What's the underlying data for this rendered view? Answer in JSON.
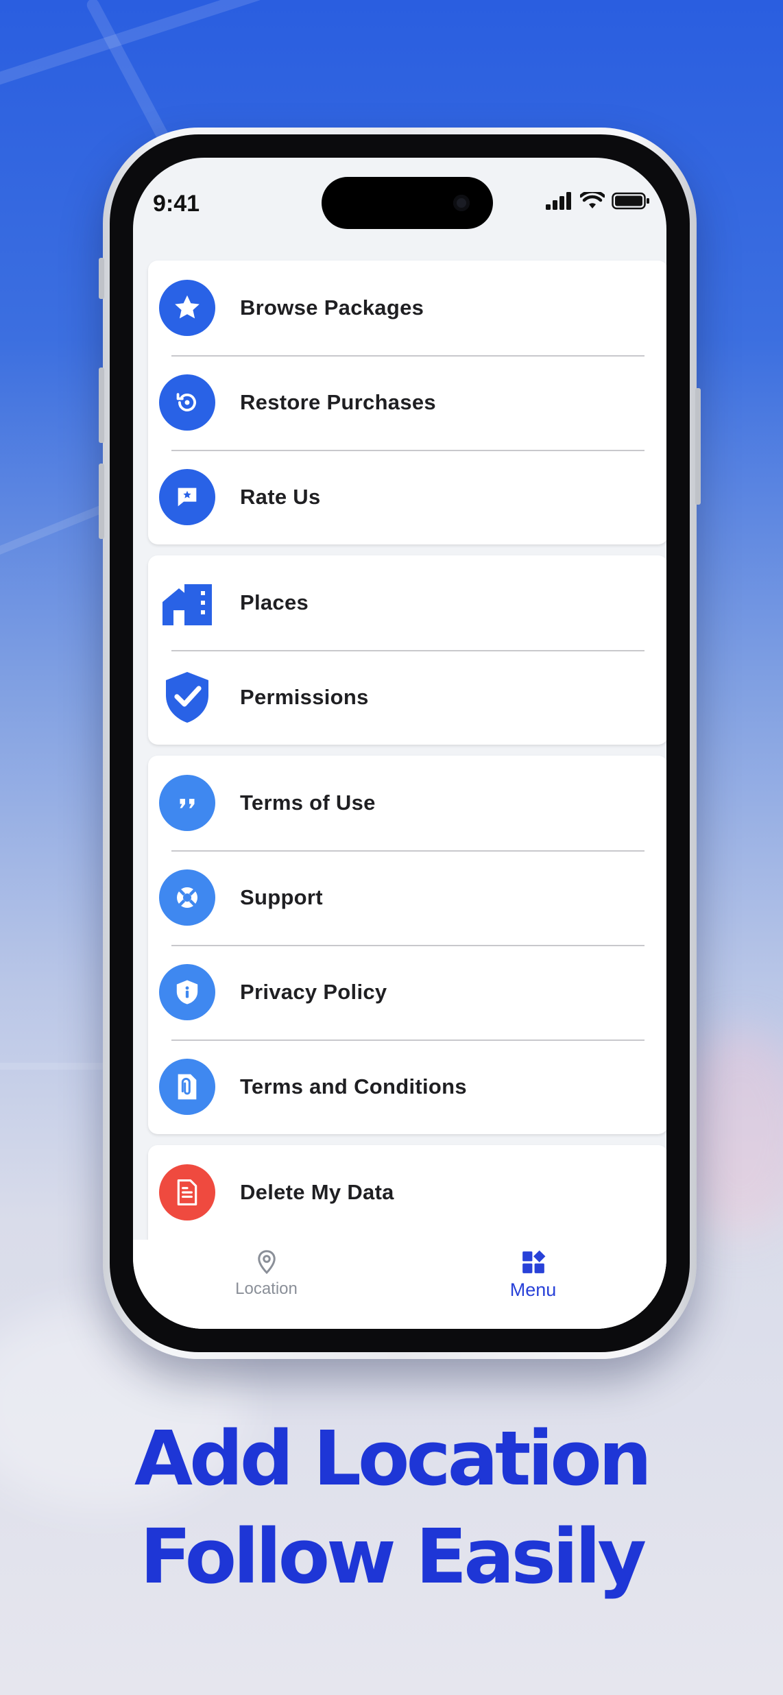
{
  "status_bar": {
    "time": "9:41"
  },
  "menu": {
    "groups": [
      {
        "items": [
          {
            "label": "Browse Packages",
            "icon": "star-icon"
          },
          {
            "label": "Restore Purchases",
            "icon": "restore-icon"
          },
          {
            "label": "Rate Us",
            "icon": "rate-chat-icon"
          }
        ]
      },
      {
        "items": [
          {
            "label": "Places",
            "icon": "home-building-icon"
          },
          {
            "label": "Permissions",
            "icon": "shield-check-icon"
          }
        ]
      },
      {
        "items": [
          {
            "label": "Terms of Use",
            "icon": "quote-icon"
          },
          {
            "label": "Support",
            "icon": "lifebuoy-icon"
          },
          {
            "label": "Privacy Policy",
            "icon": "shield-info-icon"
          },
          {
            "label": "Terms and Conditions",
            "icon": "document-clip-icon"
          }
        ]
      },
      {
        "items": [
          {
            "label": "Delete My Data",
            "icon": "document-icon"
          }
        ]
      }
    ]
  },
  "tabbar": {
    "location_label": "Location",
    "menu_label": "Menu",
    "active_tab": "Menu"
  },
  "headline": {
    "line1": "Add Location",
    "line2": "Follow Easily"
  },
  "colors": {
    "accent_blue": "#2962e6",
    "light_blue": "#3f88f0",
    "danger_red": "#ef4a3f",
    "headline_blue": "#1e36d6"
  }
}
